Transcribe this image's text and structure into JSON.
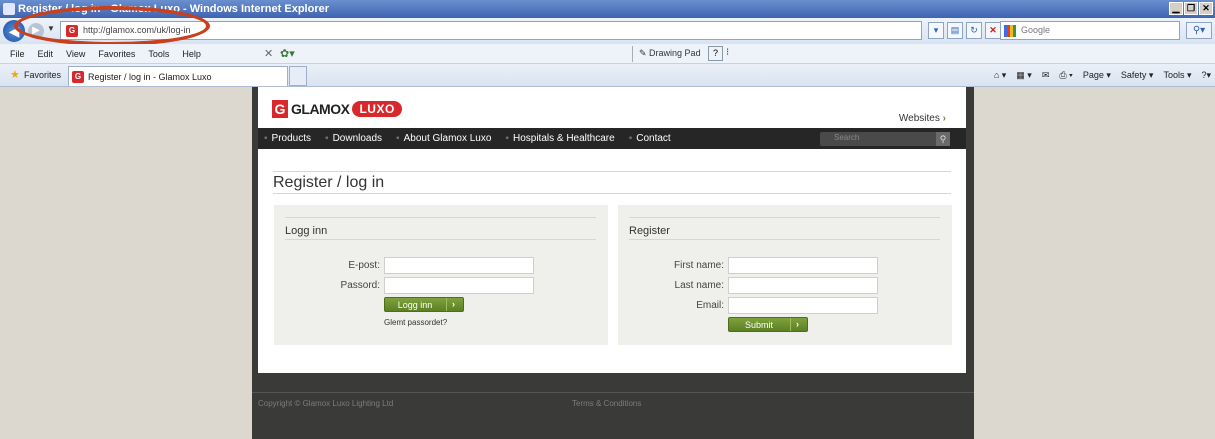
{
  "window": {
    "title": "Register / log in - Glamox Luxo - Windows Internet Explorer",
    "controls": [
      "▁",
      "❐",
      "✕"
    ]
  },
  "address_bar": {
    "url": "http://glamox.com/uk/log-in"
  },
  "search_bar": {
    "placeholder": "Google"
  },
  "menu": {
    "items": [
      "File",
      "Edit",
      "View",
      "Favorites",
      "Tools",
      "Help"
    ],
    "drawing_pad": "Drawing Pad"
  },
  "favorites_bar": {
    "favorites_label": "Favorites",
    "tab_title": "Register / log in - Glamox Luxo",
    "commands": [
      "Page ▾",
      "Safety ▾",
      "Tools ▾"
    ]
  },
  "site": {
    "brand": "GLAMOX",
    "brand_badge": "LUXO",
    "websites_link": "Websites",
    "nav": [
      "Products",
      "Downloads",
      "About Glamox Luxo",
      "Hospitals & Healthcare",
      "Contact"
    ],
    "search_placeholder": "Search",
    "page_title": "Register / log in",
    "login": {
      "heading": "Logg inn",
      "email_label": "E-post:",
      "password_label": "Passord:",
      "button": "Logg inn",
      "forgot": "Glemt passordet?"
    },
    "register": {
      "heading": "Register",
      "first_name_label": "First name:",
      "last_name_label": "Last name:",
      "email_label": "Email:",
      "button": "Submit"
    },
    "footer": {
      "copyright": "Copyright © Glamox Luxo Lighting Ltd",
      "terms": "Terms & Conditions"
    }
  },
  "colors": {
    "accent_green": "#6f8a2e",
    "brand_red": "#d8282c",
    "nav_bg": "#262626",
    "highlight_ring": "#c8401c"
  }
}
